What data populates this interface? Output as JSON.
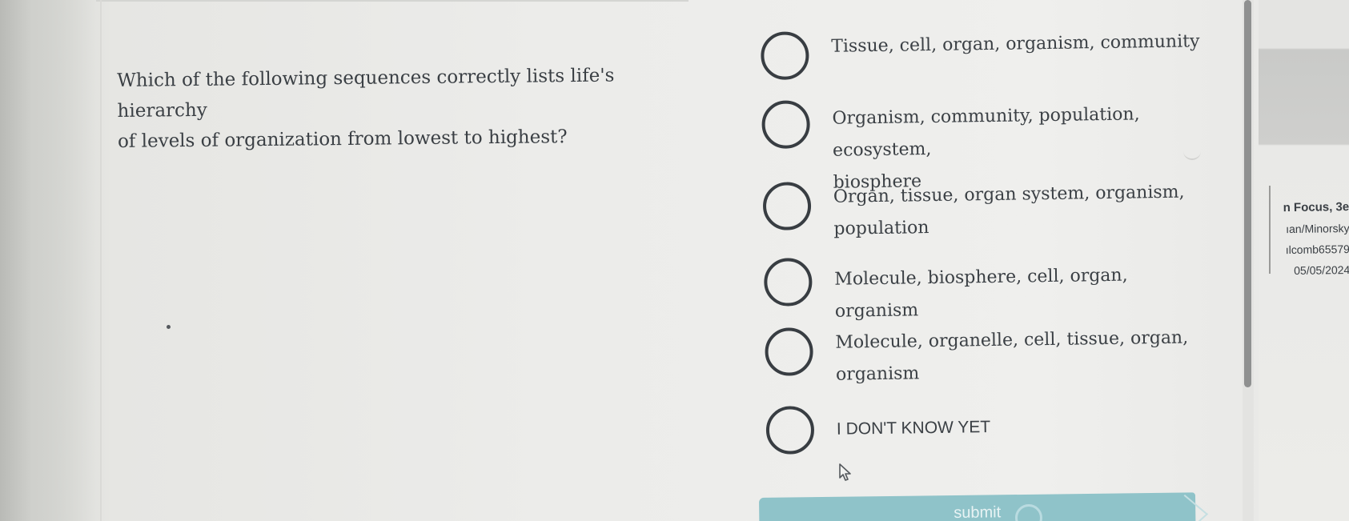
{
  "question": {
    "line1": "Which of the following sequences correctly lists life's hierarchy",
    "line2": "of levels of organization from lowest to highest?"
  },
  "options": [
    {
      "line1": "Tissue, cell, organ, organism, community",
      "line2": ""
    },
    {
      "line1": "Organism, community, population, ecosystem,",
      "line2": "biosphere"
    },
    {
      "line1": "Organ, tissue, organ system, organism,",
      "line2": "population"
    },
    {
      "line1": "Molecule, biosphere, cell, organ, organism",
      "line2": ""
    },
    {
      "line1": "Molecule, organelle, cell, tissue, organ,",
      "line2": "organism"
    },
    {
      "line1": "I DON'T KNOW YET",
      "line2": ""
    }
  ],
  "sidebar": {
    "title": "n Focus, 3e",
    "authors": "ıan/Minorsky",
    "user": "ılcomb65579",
    "date": "05/05/2024"
  },
  "submit": {
    "label": "submit"
  },
  "icons": {
    "radio": "radio-unselected-icon",
    "cursor": "mouse-pointer-icon",
    "spinner": "loading-spinner-icon"
  }
}
